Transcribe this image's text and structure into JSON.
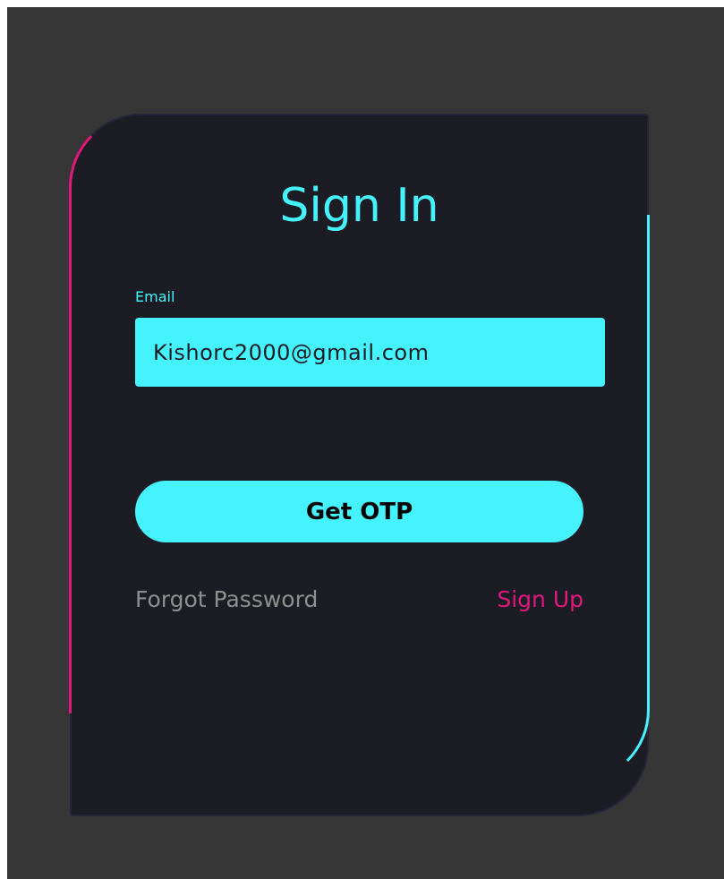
{
  "colors": {
    "page_background": "#363636",
    "card_background": "#1c1d24",
    "accent_cyan": "#45f3ff",
    "accent_pink": "#e0187e",
    "muted_text": "#8f8f8f"
  },
  "form": {
    "title": "Sign In",
    "email": {
      "label": "Email",
      "value": "Kishorc2000@gmail.com"
    },
    "submit_label": "Get OTP",
    "forgot_password_label": "Forgot Password",
    "sign_up_label": "Sign Up"
  }
}
